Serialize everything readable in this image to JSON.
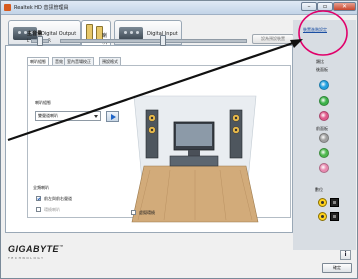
{
  "window": {
    "title": "Realtek HD 音訊管理員",
    "close_glyph": "✕",
    "min_glyph": "–",
    "max_glyph": "▫"
  },
  "device_tabs": [
    {
      "label": "Digital Output"
    },
    {
      "label": "喇叭"
    },
    {
      "label": "Digital Input"
    }
  ],
  "volume": {
    "label": "主音量",
    "left": "L",
    "right": "R",
    "balance_level": 0.5,
    "main_level": 0.55,
    "set_default_label": "設為預設裝置"
  },
  "sub_tabs": [
    {
      "label": "喇叭組態"
    },
    {
      "label": "音效"
    },
    {
      "label": "室內音場校正"
    },
    {
      "label": "預設格式"
    }
  ],
  "config": {
    "label": "喇叭組態",
    "selected": "雙聲道喇叭"
  },
  "full_range": {
    "label": "全頻喇叭",
    "front_lr_label": "前左與前右聲道",
    "front_lr_checked": true,
    "surround_label": "環繞喇叭",
    "surround_checked": false
  },
  "virtual_surround": {
    "label": "虛擬環繞",
    "checked": false
  },
  "right_panel": {
    "advanced_link": "裝置進階設定",
    "analog_label": "類比",
    "back_panel_label": "後面板",
    "front_panel_label": "前面板",
    "digital_label": "數位",
    "jack_colors": [
      "#22a0e0",
      "#3cb24a",
      "#e05a8c",
      "#a0a0a0",
      "#4fb84f",
      "#e88ab0"
    ]
  },
  "footer": {
    "brand": "GIGABYTE",
    "tm": "™",
    "brand_sub": "TECHNOLOGY",
    "info_glyph": "i",
    "ok_label": "確定"
  },
  "accent_colors": {
    "highlight_ring": "#e0006a",
    "arrow": "#111111",
    "link": "#1b4fa3"
  }
}
